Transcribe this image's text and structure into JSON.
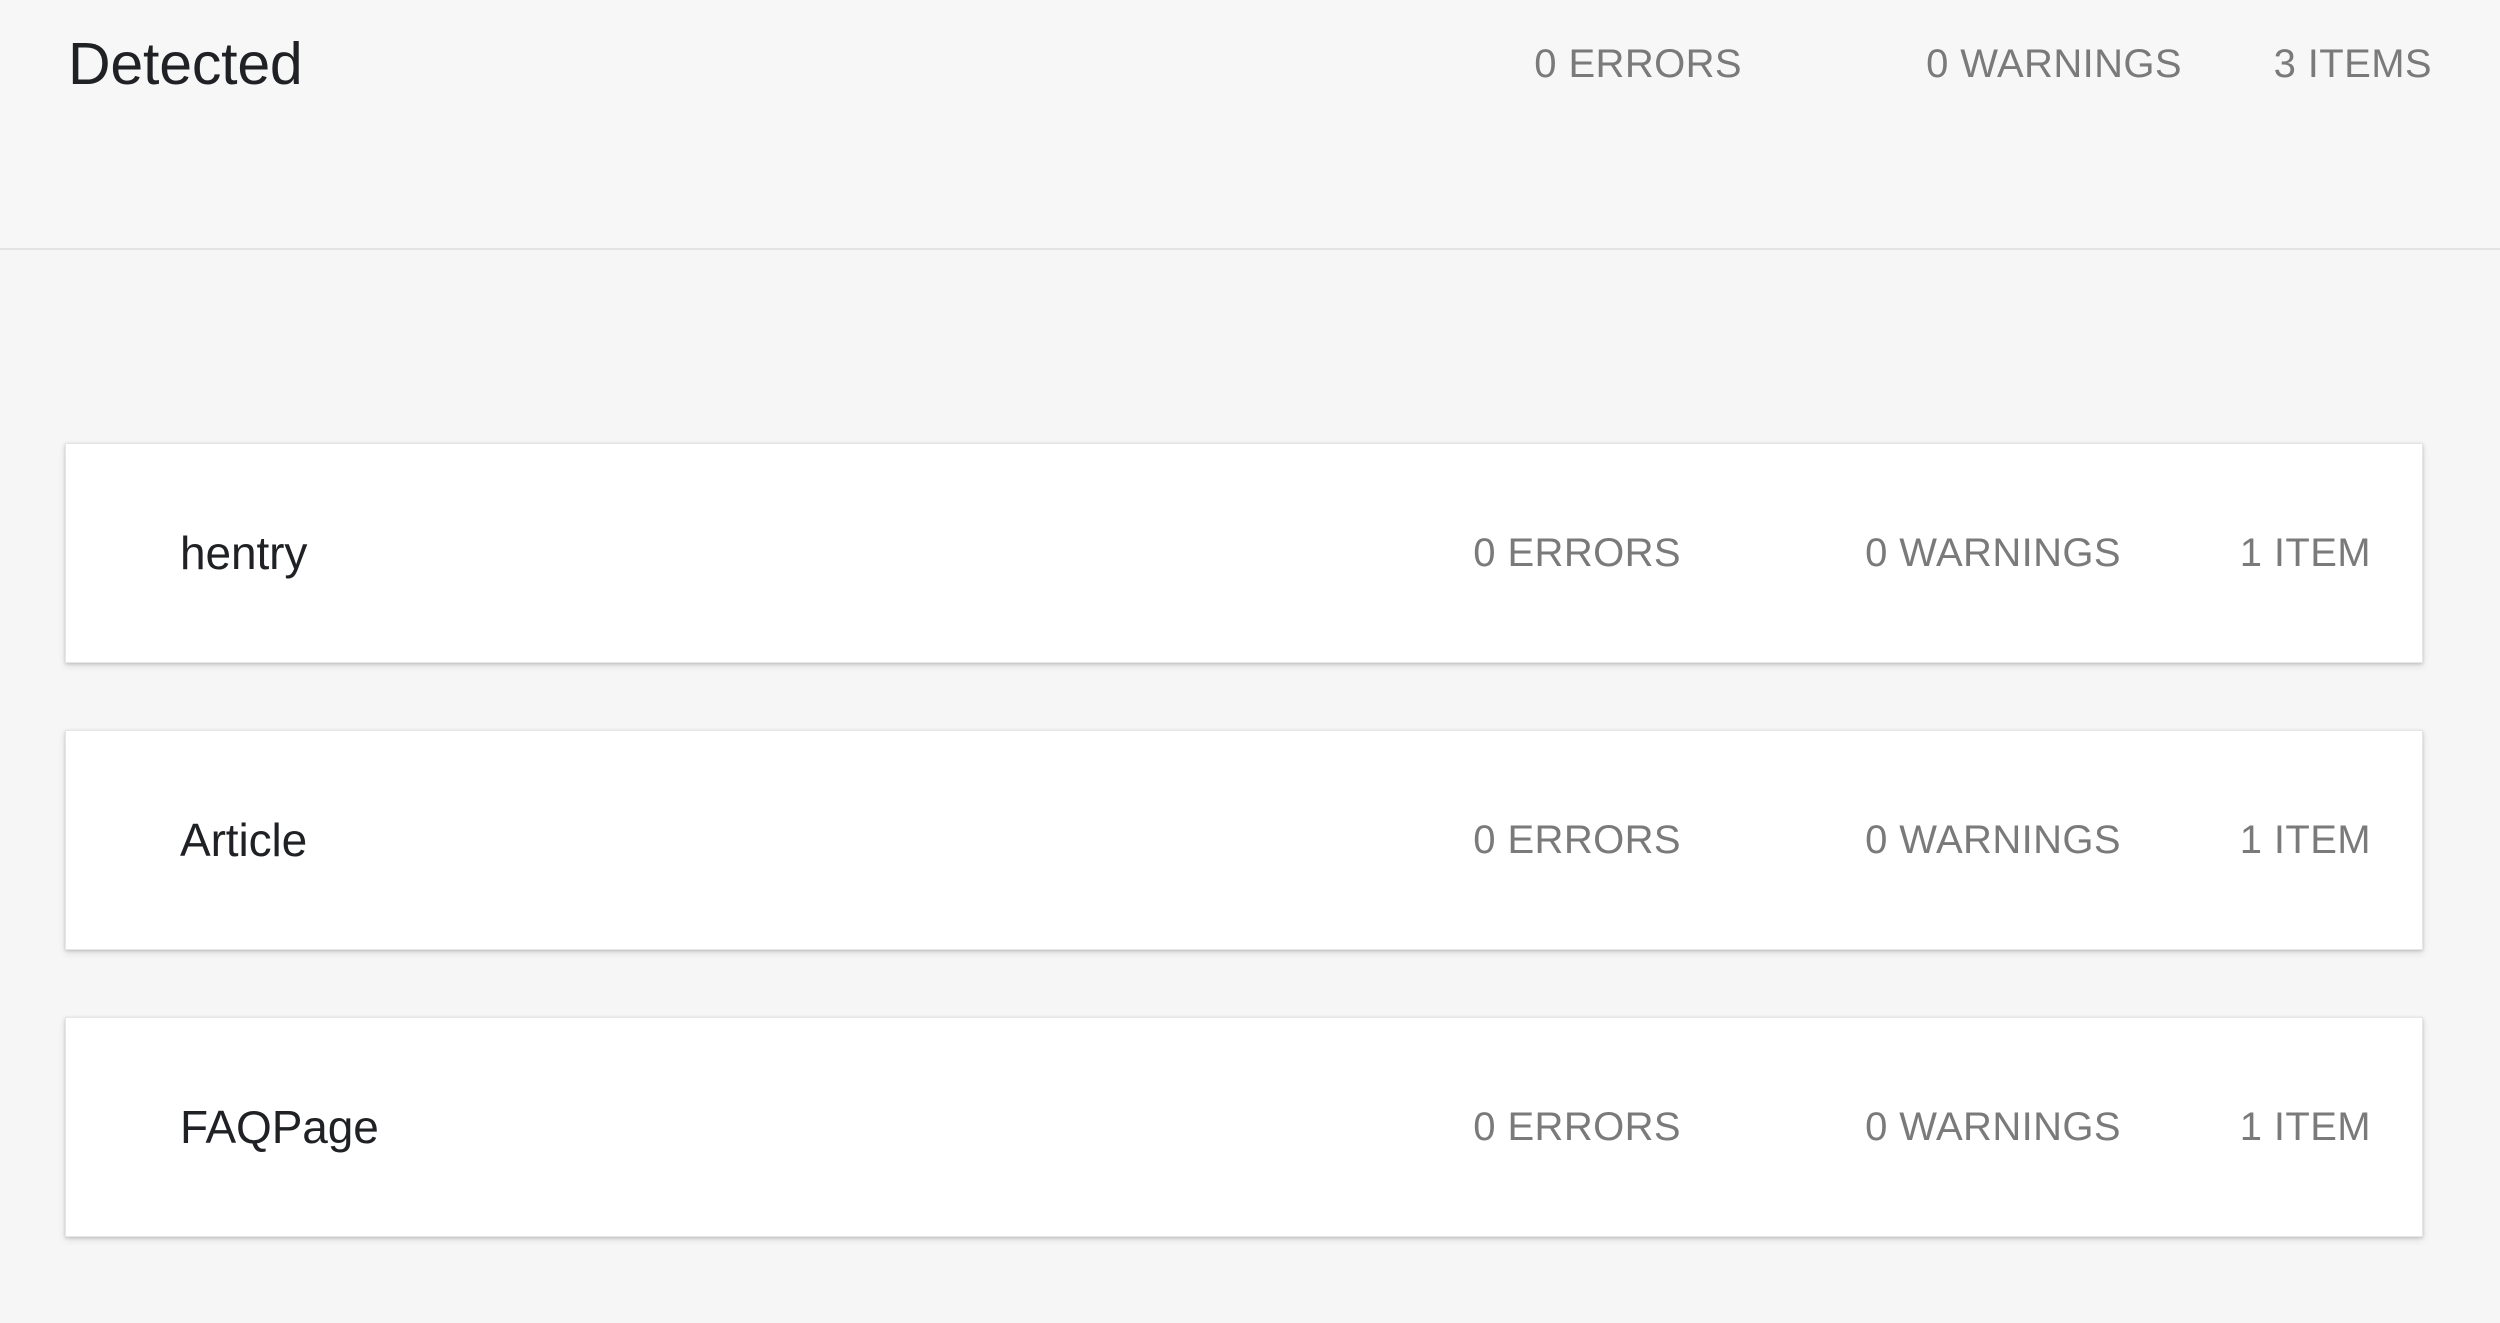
{
  "header": {
    "title": "Detected",
    "errors": "0 ERRORS",
    "warnings": "0 WARNINGS",
    "items": "3 ITEMS"
  },
  "colors": {
    "background": "#f5f5f5",
    "header_background": "#f7f7f7",
    "card_background": "#ffffff",
    "divider": "#e3e3e3",
    "title_text": "#1f2124",
    "stat_text": "#7a7a7a"
  },
  "cards": [
    {
      "label": "hentry",
      "errors": "0 ERRORS",
      "warnings": "0 WARNINGS",
      "items": "1 ITEM"
    },
    {
      "label": "Article",
      "errors": "0 ERRORS",
      "warnings": "0 WARNINGS",
      "items": "1 ITEM"
    },
    {
      "label": "FAQPage",
      "errors": "0 ERRORS",
      "warnings": "0 WARNINGS",
      "items": "1 ITEM"
    }
  ]
}
